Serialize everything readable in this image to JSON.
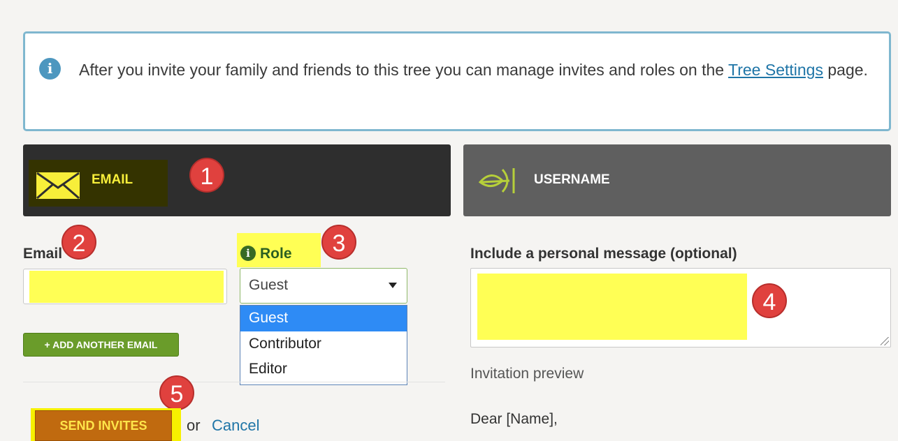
{
  "info": {
    "text_before": "After you invite your family and friends to this tree you can manage invites and roles on the ",
    "link": "Tree Settings",
    "text_after": " page."
  },
  "tabs": {
    "email": "EMAIL",
    "username": "USERNAME"
  },
  "badges": [
    "1",
    "2",
    "3",
    "4",
    "5"
  ],
  "form": {
    "email_label": "Email",
    "email_value": "",
    "role_label": "Role",
    "role_selected": "Guest",
    "role_options": [
      "Guest",
      "Contributor",
      "Editor"
    ],
    "add_email": "+ ADD ANOTHER EMAIL",
    "send": "SEND INVITES",
    "or": "or",
    "cancel": "Cancel"
  },
  "message": {
    "label": "Include a personal message (optional)",
    "value": "",
    "preview_label": "Invitation preview",
    "greeting": "Dear [Name],"
  },
  "colors": {
    "highlight": "#ffff55",
    "badge": "#e0413e",
    "link": "#1f75a7",
    "add_button": "#6a9c2a",
    "send_button": "#c06a0f"
  }
}
